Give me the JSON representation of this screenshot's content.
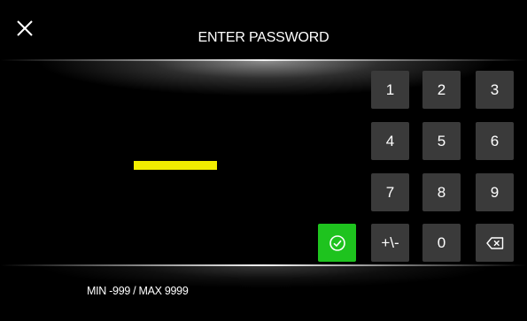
{
  "header": {
    "title": "ENTER PASSWORD",
    "close_icon": "close-icon"
  },
  "password": {
    "indicator_color": "#f2ee00"
  },
  "keypad": {
    "keys": [
      "1",
      "2",
      "3",
      "4",
      "5",
      "6",
      "7",
      "8",
      "9",
      "+\\-",
      "0"
    ],
    "ok_icon": "check-circle-icon",
    "ok_color": "#1ec31e",
    "backspace_icon": "backspace-icon",
    "key_color": "#3a3a3a"
  },
  "footer": {
    "range_text": "MIN -999 / MAX 9999"
  }
}
